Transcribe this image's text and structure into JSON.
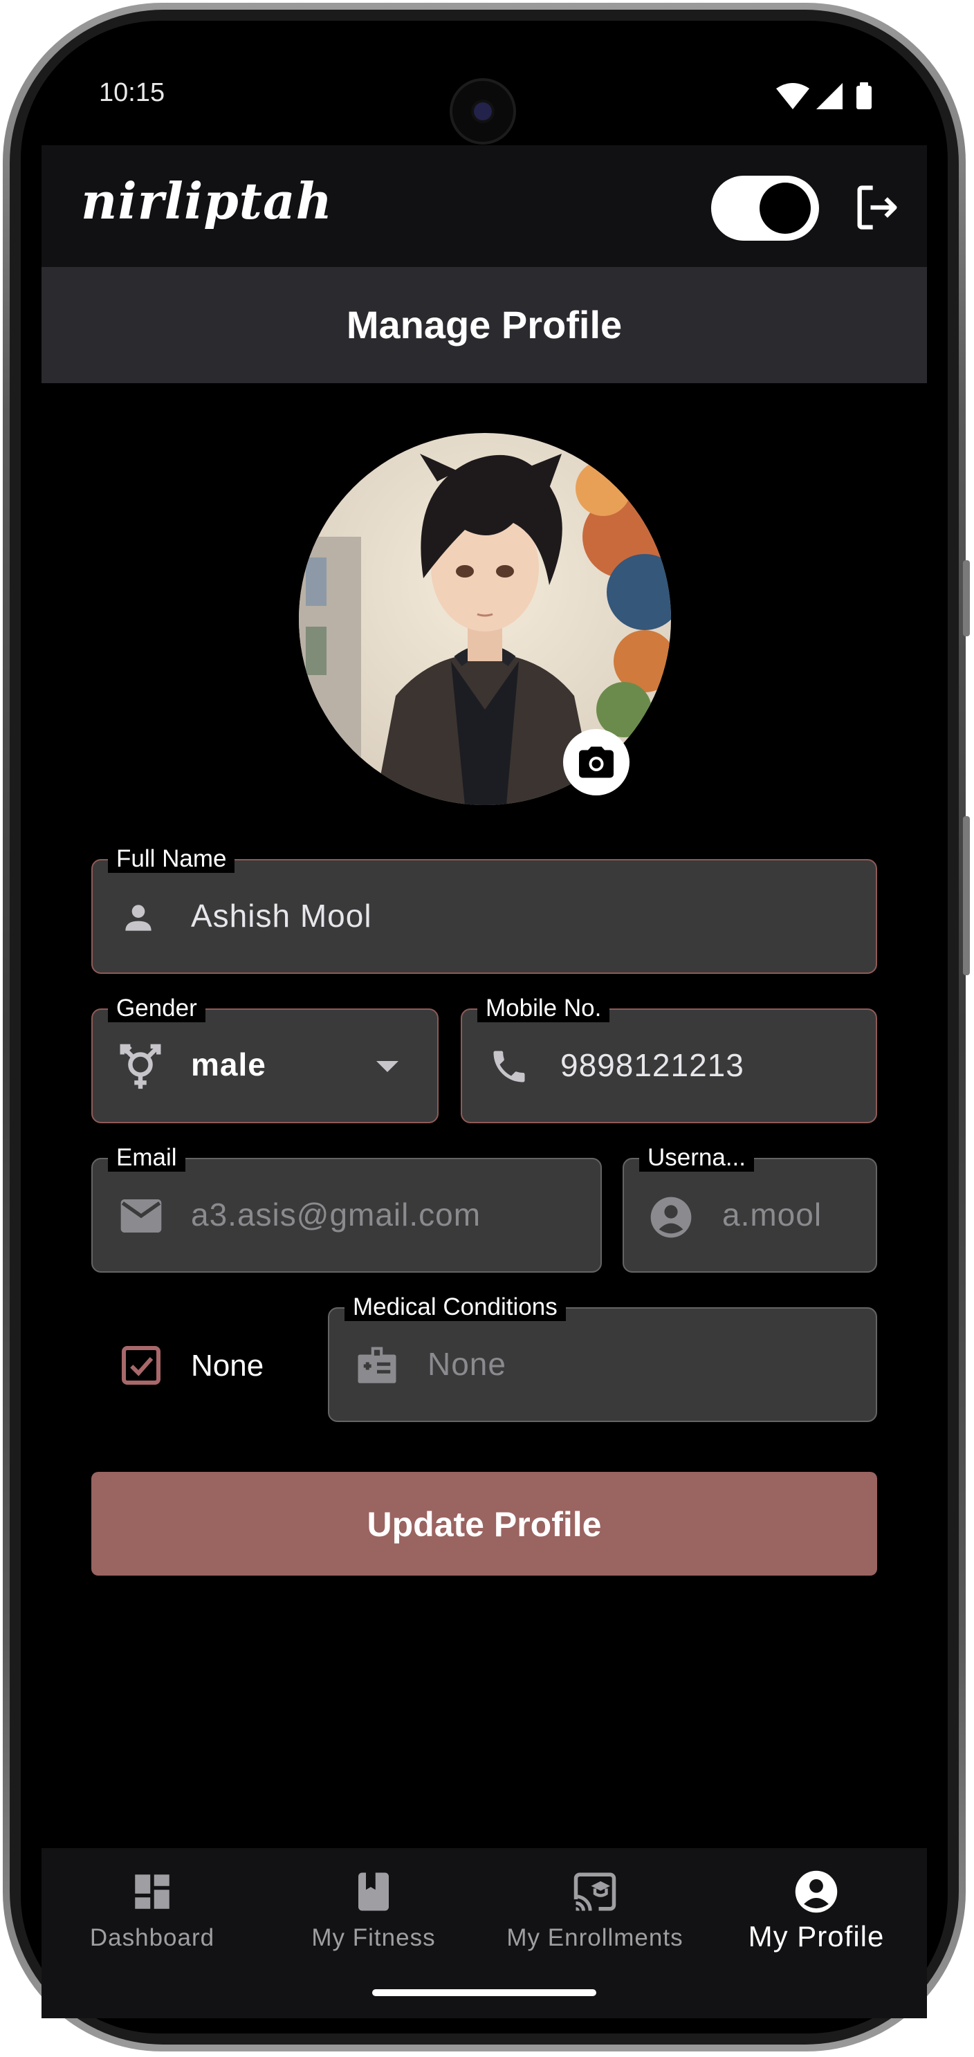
{
  "status_bar": {
    "time": "10:15"
  },
  "header": {
    "logo_text": "nirliptah",
    "theme_toggle": "on",
    "logout_icon": "logout-icon"
  },
  "page": {
    "title": "Manage Profile"
  },
  "profile": {
    "full_name": {
      "label": "Full Name",
      "value": "Ashish Mool"
    },
    "gender": {
      "label": "Gender",
      "value": "male"
    },
    "mobile": {
      "label": "Mobile No.",
      "value": "9898121213"
    },
    "email": {
      "label": "Email",
      "value": "a3.asis@gmail.com"
    },
    "username": {
      "label": "Userna...",
      "value": "a.mool"
    },
    "medical_none_checkbox": {
      "label": "None",
      "checked": true
    },
    "medical_conditions": {
      "label": "Medical Conditions",
      "value": "None"
    },
    "update_button": "Update Profile"
  },
  "bottom_nav": {
    "items": [
      {
        "label": "Dashboard",
        "icon": "dashboard-icon",
        "active": false
      },
      {
        "label": "My Fitness",
        "icon": "book-icon",
        "active": false
      },
      {
        "label": "My Enrollments",
        "icon": "cast-for-education-icon",
        "active": false
      },
      {
        "label": "My Profile",
        "icon": "account-circle-icon",
        "active": true
      }
    ]
  },
  "colors": {
    "accent": "#9a6461",
    "field_border": "#8f5a56",
    "field_bg": "#3a3a3b",
    "background": "#000000",
    "header_bg": "#111114",
    "title_bar_bg": "#2b2a2f"
  }
}
